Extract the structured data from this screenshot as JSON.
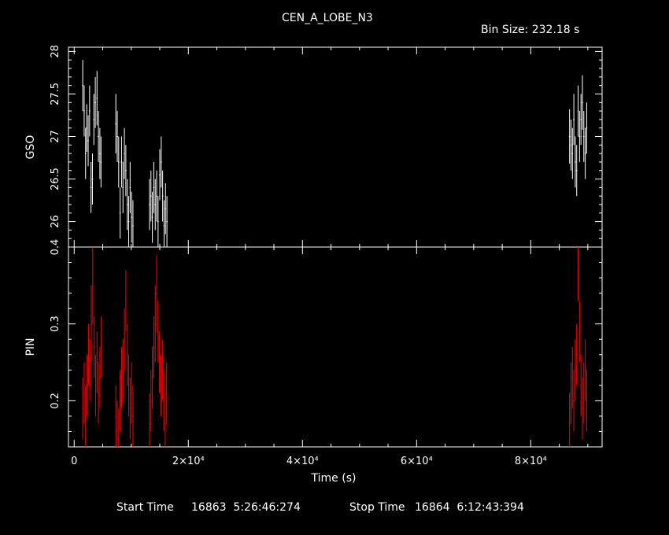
{
  "header": {
    "title": "CEN_A_LOBE_N3",
    "bin_size": "Bin Size: 232.18 s"
  },
  "footer": {
    "start_label": "Start Time",
    "start_value": "16863  5:26:46:274",
    "stop_label": "Stop Time",
    "stop_value": "16864  6:12:43:394"
  },
  "colors": {
    "background": "#000000",
    "axes": "#ffffff",
    "gso": "#ffffff",
    "pin": "#ff0000"
  },
  "chart_data": {
    "type": "scatter",
    "xlabel": "Time (s)",
    "xlim": [
      -1000,
      92500
    ],
    "x_ticks": [
      {
        "value": 0,
        "label": "0"
      },
      {
        "value": 20000,
        "label": "2×10⁴"
      },
      {
        "value": 40000,
        "label": "4×10⁴"
      },
      {
        "value": 60000,
        "label": "6×10⁴"
      },
      {
        "value": 80000,
        "label": "8×10⁴"
      }
    ],
    "panels": [
      {
        "name": "GSO",
        "ylabel": "GSO",
        "ylim": [
          25.7,
          28.05
        ],
        "y_ticks": [
          {
            "value": 26,
            "label": "26"
          },
          {
            "value": 26.5,
            "label": "26.5"
          },
          {
            "value": 27,
            "label": "27"
          },
          {
            "value": 27.5,
            "label": "27.5"
          },
          {
            "value": 28,
            "label": "28"
          }
        ],
        "x_error": 116,
        "points": [
          [
            1500,
            27.6,
            0.3
          ],
          [
            1750,
            27.3,
            0.3
          ],
          [
            2000,
            26.8,
            0.3
          ],
          [
            2200,
            27.1,
            0.28
          ],
          [
            2450,
            26.95,
            0.3
          ],
          [
            2700,
            27.3,
            0.3
          ],
          [
            2950,
            26.4,
            0.3
          ],
          [
            3200,
            26.5,
            0.3
          ],
          [
            3450,
            27.2,
            0.3
          ],
          [
            3700,
            27.4,
            0.3
          ],
          [
            4000,
            27.45,
            0.32
          ],
          [
            4250,
            27.0,
            0.3
          ],
          [
            4500,
            26.8,
            0.3
          ],
          [
            4700,
            26.7,
            0.3
          ],
          [
            7300,
            27.15,
            0.35
          ],
          [
            7550,
            27.0,
            0.3
          ],
          [
            7800,
            26.7,
            0.3
          ],
          [
            8050,
            26.1,
            0.3
          ],
          [
            8300,
            26.7,
            0.3
          ],
          [
            8550,
            26.4,
            0.3
          ],
          [
            8800,
            26.8,
            0.3
          ],
          [
            9050,
            26.6,
            0.3
          ],
          [
            9300,
            26.2,
            0.3
          ],
          [
            9550,
            26.0,
            0.3
          ],
          [
            9800,
            26.4,
            0.3
          ],
          [
            10050,
            26.05,
            0.3
          ],
          [
            10300,
            25.95,
            0.3
          ],
          [
            13200,
            26.2,
            0.3
          ],
          [
            13450,
            26.3,
            0.3
          ],
          [
            13700,
            26.05,
            0.3
          ],
          [
            13950,
            26.4,
            0.3
          ],
          [
            14200,
            26.2,
            0.3
          ],
          [
            14450,
            26.3,
            0.3
          ],
          [
            14700,
            26.0,
            0.3
          ],
          [
            15000,
            26.55,
            0.3
          ],
          [
            15250,
            26.7,
            0.3
          ],
          [
            15500,
            26.3,
            0.3
          ],
          [
            15750,
            25.95,
            0.3
          ],
          [
            16000,
            26.15,
            0.3
          ],
          [
            16250,
            26.0,
            0.3
          ],
          [
            86800,
            27.0,
            0.32
          ],
          [
            87050,
            26.9,
            0.3
          ],
          [
            87300,
            26.8,
            0.3
          ],
          [
            87550,
            27.2,
            0.3
          ],
          [
            87800,
            26.7,
            0.3
          ],
          [
            88050,
            26.6,
            0.3
          ],
          [
            88300,
            27.3,
            0.3
          ],
          [
            88550,
            27.0,
            0.3
          ],
          [
            88800,
            27.2,
            0.3
          ],
          [
            89050,
            27.4,
            0.32
          ],
          [
            89300,
            27.0,
            0.3
          ],
          [
            89550,
            26.8,
            0.3
          ],
          [
            89800,
            27.1,
            0.3
          ]
        ]
      },
      {
        "name": "PIN",
        "ylabel": "PIN",
        "ylim": [
          0.14,
          0.4
        ],
        "y_ticks": [
          {
            "value": 0.2,
            "label": "0.2"
          },
          {
            "value": 0.3,
            "label": "0.3"
          },
          {
            "value": 0.4,
            "label": "0.4"
          }
        ],
        "x_error": 116,
        "points": [
          [
            1500,
            0.19,
            0.04
          ],
          [
            1750,
            0.21,
            0.04
          ],
          [
            2000,
            0.18,
            0.04
          ],
          [
            2250,
            0.22,
            0.04
          ],
          [
            2500,
            0.26,
            0.04
          ],
          [
            2750,
            0.24,
            0.04
          ],
          [
            3000,
            0.3,
            0.05
          ],
          [
            3250,
            0.35,
            0.05
          ],
          [
            3500,
            0.27,
            0.04
          ],
          [
            3750,
            0.22,
            0.04
          ],
          [
            4000,
            0.25,
            0.04
          ],
          [
            4250,
            0.21,
            0.04
          ],
          [
            4500,
            0.23,
            0.04
          ],
          [
            4750,
            0.27,
            0.04
          ],
          [
            7300,
            0.18,
            0.04
          ],
          [
            7550,
            0.16,
            0.04
          ],
          [
            7800,
            0.15,
            0.04
          ],
          [
            8050,
            0.2,
            0.04
          ],
          [
            8300,
            0.23,
            0.04
          ],
          [
            8550,
            0.24,
            0.04
          ],
          [
            8800,
            0.28,
            0.04
          ],
          [
            9050,
            0.33,
            0.04
          ],
          [
            9300,
            0.26,
            0.04
          ],
          [
            9550,
            0.22,
            0.04
          ],
          [
            9800,
            0.19,
            0.04
          ],
          [
            10050,
            0.21,
            0.04
          ],
          [
            10300,
            0.18,
            0.04
          ],
          [
            13200,
            0.17,
            0.04
          ],
          [
            13450,
            0.2,
            0.04
          ],
          [
            13700,
            0.23,
            0.04
          ],
          [
            13950,
            0.27,
            0.04
          ],
          [
            14200,
            0.3,
            0.05
          ],
          [
            14450,
            0.34,
            0.05
          ],
          [
            14700,
            0.29,
            0.04
          ],
          [
            14950,
            0.25,
            0.04
          ],
          [
            15200,
            0.22,
            0.04
          ],
          [
            15450,
            0.24,
            0.04
          ],
          [
            15700,
            0.2,
            0.04
          ],
          [
            15950,
            0.17,
            0.04
          ],
          [
            16200,
            0.21,
            0.04
          ],
          [
            86800,
            0.17,
            0.04
          ],
          [
            87050,
            0.21,
            0.04
          ],
          [
            87300,
            0.23,
            0.04
          ],
          [
            87550,
            0.2,
            0.04
          ],
          [
            87800,
            0.24,
            0.04
          ],
          [
            88050,
            0.26,
            0.04
          ],
          [
            88300,
            0.37,
            0.04
          ],
          [
            88550,
            0.29,
            0.04
          ],
          [
            88800,
            0.22,
            0.04
          ],
          [
            89050,
            0.19,
            0.04
          ],
          [
            89300,
            0.21,
            0.04
          ],
          [
            89550,
            0.24,
            0.04
          ],
          [
            89800,
            0.2,
            0.04
          ]
        ]
      }
    ]
  }
}
